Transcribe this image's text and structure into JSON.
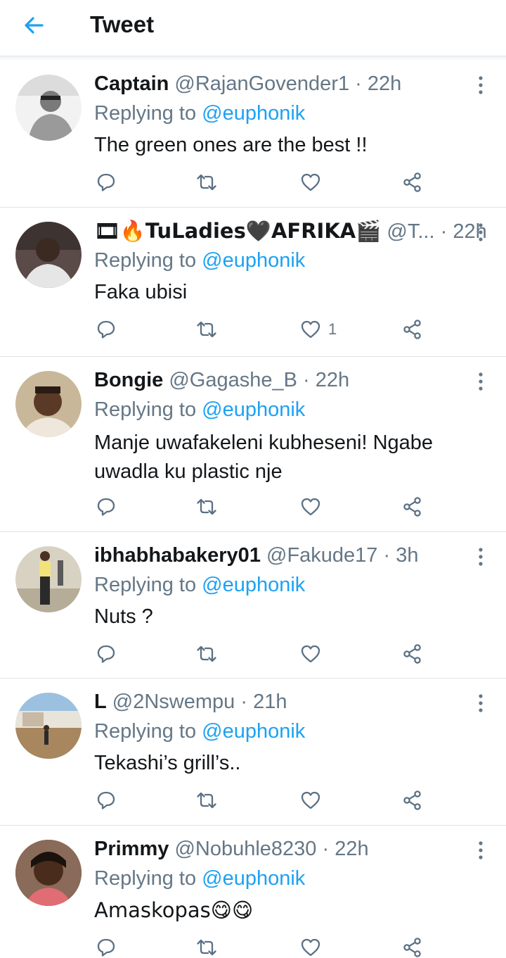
{
  "header": {
    "title": "Tweet",
    "back_icon": "arrow-left-icon",
    "accent": "#1da1f2"
  },
  "tweets": [
    {
      "name": "Captain",
      "handle": "@RajanGovender1",
      "sep": "·",
      "time": "22h",
      "replying_prefix": "Replying to",
      "replying_to": "@euphonik",
      "text": "The green ones are the best !!",
      "likes": ""
    },
    {
      "name": "🎞🔥TuLadies🖤AFRIKA🎬",
      "handle": "@T...",
      "sep": "·",
      "time": "22h",
      "replying_prefix": "Replying to",
      "replying_to": "@euphonik",
      "text": "Faka ubisi",
      "likes": "1"
    },
    {
      "name": "Bongie",
      "handle": "@Gagashe_B",
      "sep": "·",
      "time": "22h",
      "replying_prefix": "Replying to",
      "replying_to": "@euphonik",
      "text": "Manje uwafakeleni kubheseni! Ngabe uwadla ku plastic nje",
      "likes": ""
    },
    {
      "name": "ibhabhabakery01",
      "handle": "@Fakude17",
      "sep": "·",
      "time": "3h",
      "replying_prefix": "Replying to",
      "replying_to": "@euphonik",
      "text": "Nuts ?",
      "likes": ""
    },
    {
      "name": "L",
      "handle": "@2Nswempu",
      "sep": "·",
      "time": "21h",
      "replying_prefix": "Replying to",
      "replying_to": "@euphonik",
      "text": "Tekashi’s grill’s..",
      "likes": ""
    },
    {
      "name": "Primmy",
      "handle": "@Nobuhle8230",
      "sep": "·",
      "time": "22h",
      "replying_prefix": "Replying to",
      "replying_to": "@euphonik",
      "text": "Amaskopas😋😋",
      "likes": ""
    }
  ],
  "icons": {
    "more": "more-vertical-icon",
    "reply": "reply-icon",
    "retweet": "retweet-icon",
    "like": "heart-icon",
    "share": "share-icon"
  }
}
